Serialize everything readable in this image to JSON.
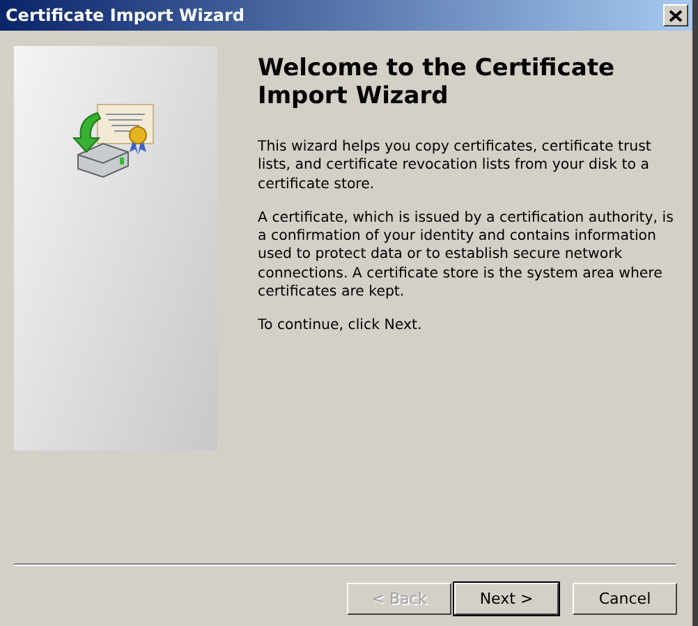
{
  "window": {
    "title": "Certificate Import Wizard"
  },
  "heading": "Welcome to the Certificate Import Wizard",
  "paragraphs": [
    "This wizard helps you copy certificates, certificate trust lists, and certificate revocation lists from your disk to a certificate store.",
    "A certificate, which is issued by a certification authority, is a confirmation of your identity and contains information used to protect data or to establish secure network connections. A certificate store is the system area where certificates are kept.",
    "To continue, click Next."
  ],
  "buttons": [
    {
      "label": "< Back",
      "disabled": true,
      "default": false
    },
    {
      "label": "Next >",
      "disabled": false,
      "default": true
    },
    {
      "label": "Cancel",
      "disabled": false,
      "default": false
    }
  ]
}
